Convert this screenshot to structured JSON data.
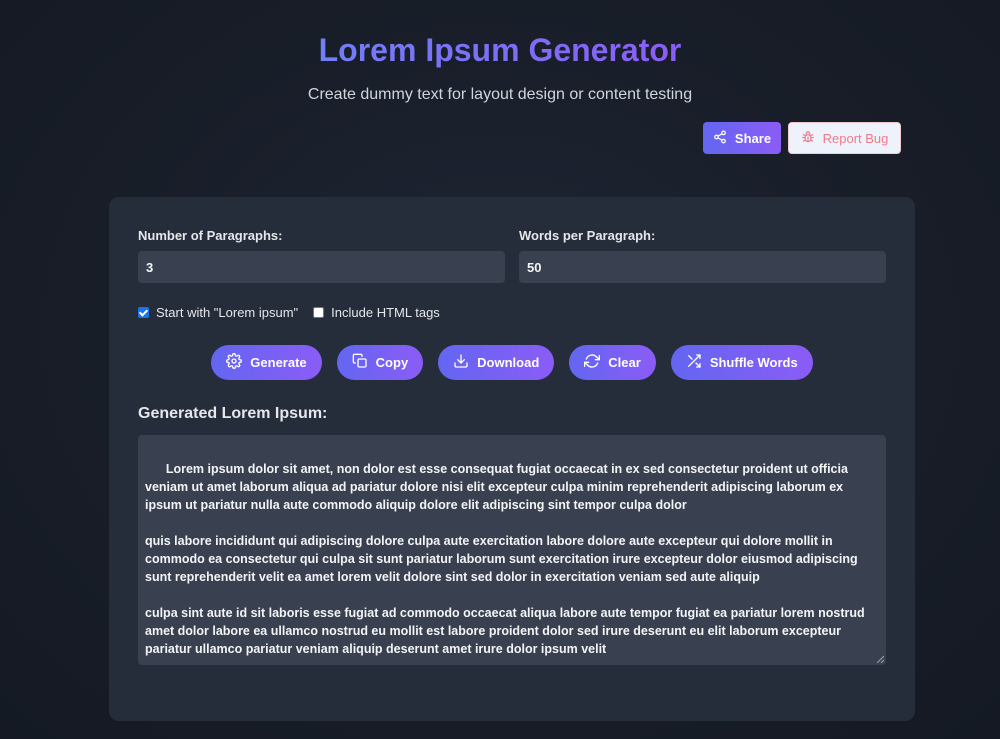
{
  "header": {
    "title": "Lorem Ipsum Generator",
    "subtitle": "Create dummy text for layout design or content testing"
  },
  "top_actions": {
    "share_label": "Share",
    "report_label": "Report Bug"
  },
  "form": {
    "paragraphs_label": "Number of Paragraphs:",
    "paragraphs_value": "3",
    "words_label": "Words per Paragraph:",
    "words_value": "50",
    "start_lorem_label": "Start with \"Lorem ipsum\"",
    "start_lorem_checked": true,
    "html_tags_label": "Include HTML tags",
    "html_tags_checked": false
  },
  "actions": {
    "generate": "Generate",
    "copy": "Copy",
    "download": "Download",
    "clear": "Clear",
    "shuffle": "Shuffle Words"
  },
  "output": {
    "heading": "Generated Lorem Ipsum:",
    "text": "Lorem ipsum dolor sit amet, non dolor est esse consequat fugiat occaecat in ex sed consectetur proident ut officia veniam ut amet laborum aliqua ad pariatur dolore nisi elit excepteur culpa minim reprehenderit adipiscing laborum ex ipsum ut pariatur nulla aute commodo aliquip dolore elit adipiscing sint tempor culpa dolor\n\nquis labore incididunt qui adipiscing dolore culpa aute exercitation labore dolore aute excepteur qui dolore mollit in commodo ea consectetur qui culpa sit sunt pariatur laborum sunt exercitation irure excepteur dolor eiusmod adipiscing sunt reprehenderit velit ea amet lorem velit dolore sint sed dolor in exercitation veniam sed aute aliquip\n\nculpa sint aute id sit laboris esse fugiat ad commodo occaecat aliqua labore aute tempor fugiat ea pariatur lorem nostrud amet dolor labore ea ullamco nostrud eu mollit est labore proident dolor sed irure deserunt eu elit laborum excepteur pariatur ullamco pariatur veniam aliquip deserunt amet irure dolor ipsum velit"
  },
  "colors": {
    "accent_start": "#6366f1",
    "accent_end": "#8b5cf6",
    "report_text": "#f07a8a",
    "card_bg": "#252d3b",
    "input_bg": "#394150"
  },
  "icons": {
    "share": "share-icon",
    "report": "bug-icon",
    "generate": "gear-icon",
    "copy": "copy-icon",
    "download": "download-icon",
    "clear": "refresh-icon",
    "shuffle": "shuffle-icon"
  }
}
